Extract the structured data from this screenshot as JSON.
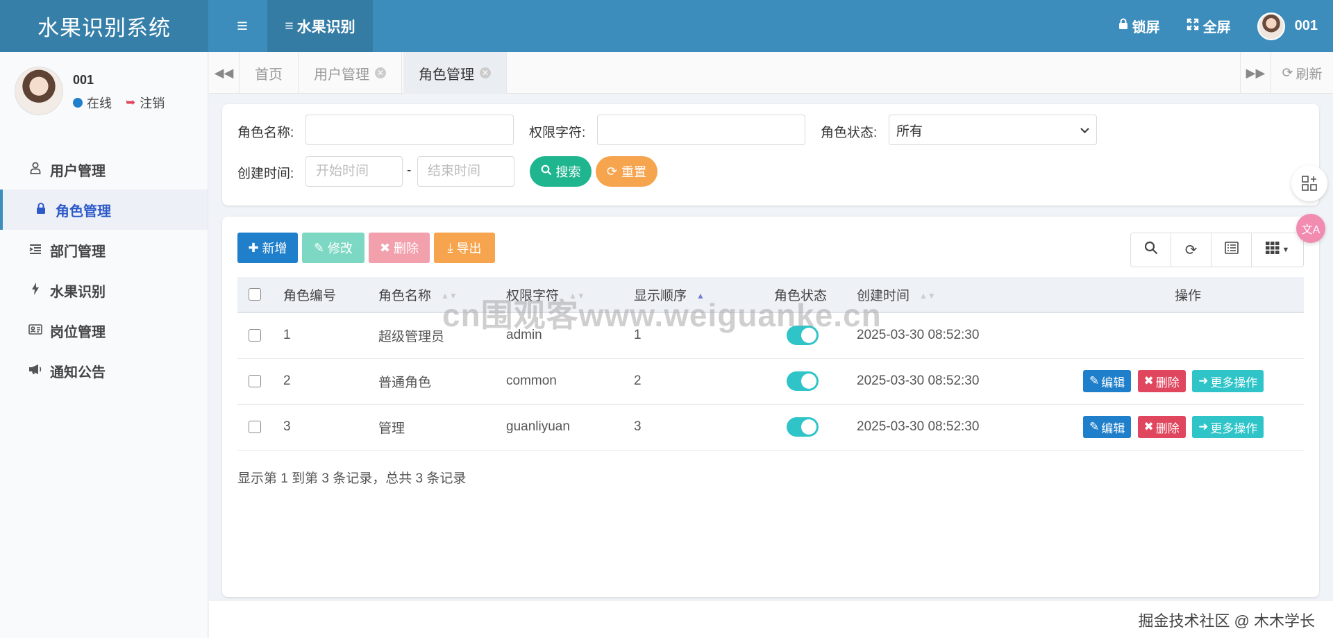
{
  "header": {
    "app_title": "水果识别系统",
    "menu_toggle_icon": "≡",
    "active_nav": "水果识别",
    "lock_label": "锁屏",
    "fullscreen_label": "全屏",
    "user": "001"
  },
  "sidebar": {
    "user_name": "001",
    "status_online": "在线",
    "logout": "注销",
    "items": [
      {
        "label": "用户管理",
        "icon": "user-icon"
      },
      {
        "label": "角色管理",
        "icon": "lock-icon",
        "active": true
      },
      {
        "label": "部门管理",
        "icon": "list-indent-icon"
      },
      {
        "label": "水果识别",
        "icon": "bolt-icon"
      },
      {
        "label": "岗位管理",
        "icon": "id-card-icon"
      },
      {
        "label": "通知公告",
        "icon": "megaphone-icon"
      }
    ]
  },
  "tabs": {
    "items": [
      {
        "label": "首页"
      },
      {
        "label": "用户管理"
      },
      {
        "label": "角色管理",
        "active": true
      }
    ],
    "refresh_label": "刷新"
  },
  "search": {
    "role_name_label": "角色名称:",
    "perm_label": "权限字符:",
    "status_label": "角色状态:",
    "status_value": "所有",
    "created_label": "创建时间:",
    "start_placeholder": "开始时间",
    "end_placeholder": "结束时间",
    "date_sep": "-",
    "search_btn": "搜索",
    "reset_btn": "重置"
  },
  "toolbar": {
    "add": "新增",
    "edit": "修改",
    "delete": "删除",
    "export": "导出"
  },
  "table": {
    "columns": [
      "角色编号",
      "角色名称",
      "权限字符",
      "显示顺序",
      "角色状态",
      "创建时间",
      "操作"
    ],
    "rows": [
      {
        "id": "1",
        "name": "超级管理员",
        "key": "admin",
        "order": "1",
        "status_on": true,
        "created": "2025-03-30 08:52:30",
        "actions": false
      },
      {
        "id": "2",
        "name": "普通角色",
        "key": "common",
        "order": "2",
        "status_on": true,
        "created": "2025-03-30 08:52:30",
        "actions": true
      },
      {
        "id": "3",
        "name": "管理",
        "key": "guanliyuan",
        "order": "3",
        "status_on": true,
        "created": "2025-03-30 08:52:30",
        "actions": true
      }
    ],
    "action_edit": "编辑",
    "action_delete": "删除",
    "action_more": "更多操作",
    "pagination_info": "显示第 1 到第 3 条记录，总共 3 条记录"
  },
  "watermark": "cn围观客www.weiguanke.cn",
  "footer_mark": "掘金技术社区 @ 木木学长",
  "colors": {
    "header": "#3c8dbc",
    "primary": "#1f7fcb",
    "danger": "#e0465e",
    "info": "#2fc4c8",
    "success": "#1fb58f",
    "warning": "#f6a44e"
  }
}
